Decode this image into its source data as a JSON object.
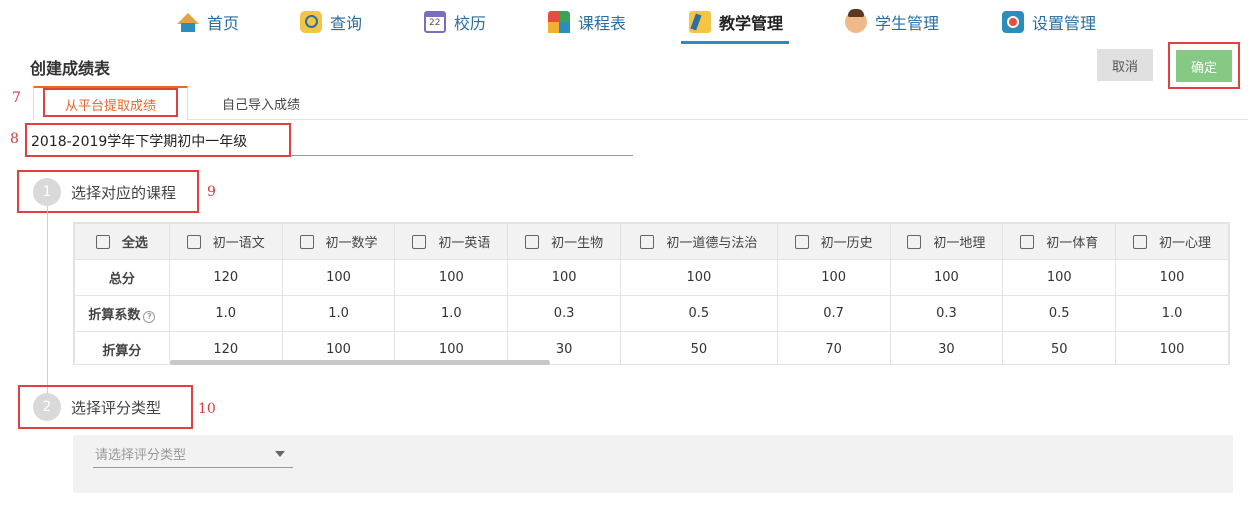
{
  "nav": [
    {
      "label": "首页",
      "icon": "home-icon"
    },
    {
      "label": "查询",
      "icon": "search-icon"
    },
    {
      "label": "校历",
      "icon": "calendar-icon"
    },
    {
      "label": "课程表",
      "icon": "schedule-icon"
    },
    {
      "label": "教学管理",
      "icon": "teaching-icon",
      "active": true
    },
    {
      "label": "学生管理",
      "icon": "student-icon"
    },
    {
      "label": "设置管理",
      "icon": "settings-icon"
    }
  ],
  "page_title": "创建成绩表",
  "buttons": {
    "cancel": "取消",
    "confirm": "确定"
  },
  "tabs": {
    "platform": "从平台提取成绩",
    "import": "自己导入成绩"
  },
  "name_value": "2018-2019学年下学期初中一年级",
  "annotations": {
    "a7": "7",
    "a8": "8",
    "a9": "9",
    "a10": "10"
  },
  "step1": {
    "num": "1",
    "label": "选择对应的课程"
  },
  "step2": {
    "num": "2",
    "label": "选择评分类型"
  },
  "table": {
    "select_all": "全选",
    "courses": [
      "初一语文",
      "初一数学",
      "初一英语",
      "初一生物",
      "初一道德与法治",
      "初一历史",
      "初一地理",
      "初一体育",
      "初一心理"
    ],
    "rows": [
      {
        "label": "总分",
        "values": [
          "120",
          "100",
          "100",
          "100",
          "100",
          "100",
          "100",
          "100",
          "100"
        ]
      },
      {
        "label": "折算系数",
        "help": "?",
        "values": [
          "1.0",
          "1.0",
          "1.0",
          "0.3",
          "0.5",
          "0.7",
          "0.3",
          "0.5",
          "1.0"
        ]
      },
      {
        "label": "折算分",
        "values": [
          "120",
          "100",
          "100",
          "30",
          "50",
          "70",
          "30",
          "50",
          "100"
        ]
      }
    ]
  },
  "grading_type": {
    "placeholder": "请选择评分类型"
  },
  "colors": {
    "accent_orange": "#e8682b",
    "annotation_red": "#e0403f",
    "confirm_green": "#85c985",
    "nav_blue": "#2b8dbb"
  }
}
